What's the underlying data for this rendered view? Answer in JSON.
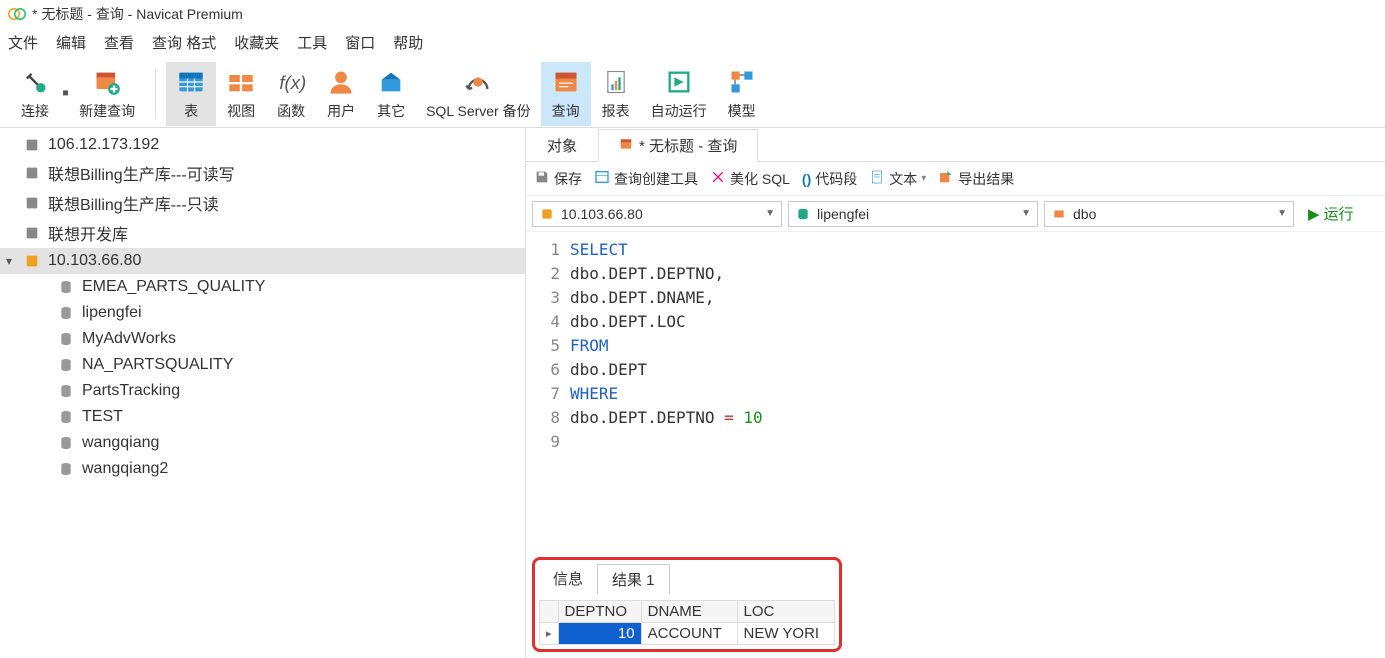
{
  "window": {
    "title": "* 无标题 - 查询 - Navicat Premium"
  },
  "menu": {
    "file": "文件",
    "edit": "编辑",
    "view": "查看",
    "query_format": "查询 格式",
    "favorites": "收藏夹",
    "tools": "工具",
    "window": "窗口",
    "help": "帮助"
  },
  "toolbar": {
    "connect": "连接",
    "new_query": "新建查询",
    "table": "表",
    "view": "视图",
    "function": "函数",
    "user": "用户",
    "other": "其它",
    "backup": "SQL Server 备份",
    "query": "查询",
    "report": "报表",
    "autorun": "自动运行",
    "model": "模型"
  },
  "sidebar": {
    "items": [
      {
        "name": "106.12.173.192",
        "type": "conn"
      },
      {
        "name": "联想Billing生产库---可读写",
        "type": "conn"
      },
      {
        "name": "联想Billing生产库---只读",
        "type": "conn"
      },
      {
        "name": "联想开发库",
        "type": "conn"
      },
      {
        "name": "10.103.66.80",
        "type": "conn-open",
        "selected": true
      },
      {
        "name": "EMEA_PARTS_QUALITY",
        "type": "db"
      },
      {
        "name": "lipengfei",
        "type": "db"
      },
      {
        "name": "MyAdvWorks",
        "type": "db"
      },
      {
        "name": "NA_PARTSQUALITY",
        "type": "db"
      },
      {
        "name": "PartsTracking",
        "type": "db"
      },
      {
        "name": "TEST",
        "type": "db"
      },
      {
        "name": "wangqiang",
        "type": "db"
      },
      {
        "name": "wangqiang2",
        "type": "db"
      }
    ]
  },
  "tabs": {
    "objects": "对象",
    "query_tab": "* 无标题 - 查询"
  },
  "sub_toolbar": {
    "save": "保存",
    "builder": "查询创建工具",
    "beautify": "美化 SQL",
    "snippet": "代码段",
    "text": "文本",
    "export": "导出结果"
  },
  "selectors": {
    "conn": "10.103.66.80",
    "db": "lipengfei",
    "schema": "dbo",
    "run": "运行"
  },
  "sql": {
    "lines": [
      {
        "n": "1",
        "tokens": [
          {
            "t": "SELECT",
            "c": "kw"
          }
        ]
      },
      {
        "n": "2",
        "tokens": [
          {
            "t": "dbo.DEPT.DEPTNO,",
            "c": ""
          }
        ]
      },
      {
        "n": "3",
        "tokens": [
          {
            "t": "dbo.DEPT.DNAME,",
            "c": ""
          }
        ]
      },
      {
        "n": "4",
        "tokens": [
          {
            "t": "dbo.DEPT.LOC",
            "c": ""
          }
        ]
      },
      {
        "n": "5",
        "tokens": [
          {
            "t": "FROM",
            "c": "kw"
          }
        ]
      },
      {
        "n": "6",
        "tokens": [
          {
            "t": "dbo.DEPT",
            "c": ""
          }
        ]
      },
      {
        "n": "7",
        "tokens": [
          {
            "t": "WHERE",
            "c": "kw"
          }
        ]
      },
      {
        "n": "8",
        "tokens": [
          {
            "t": "dbo.DEPT.DEPTNO ",
            "c": ""
          },
          {
            "t": "=",
            "c": "op"
          },
          {
            "t": " ",
            "c": ""
          },
          {
            "t": "10",
            "c": "num"
          }
        ]
      },
      {
        "n": "9",
        "tokens": [
          {
            "t": "",
            "c": ""
          }
        ]
      }
    ]
  },
  "result": {
    "tab_info": "信息",
    "tab_result": "结果 1",
    "headers": [
      "DEPTNO",
      "DNAME",
      "LOC"
    ],
    "row": {
      "deptno": "10",
      "dname": "ACCOUNT",
      "loc": "NEW YORI"
    }
  }
}
